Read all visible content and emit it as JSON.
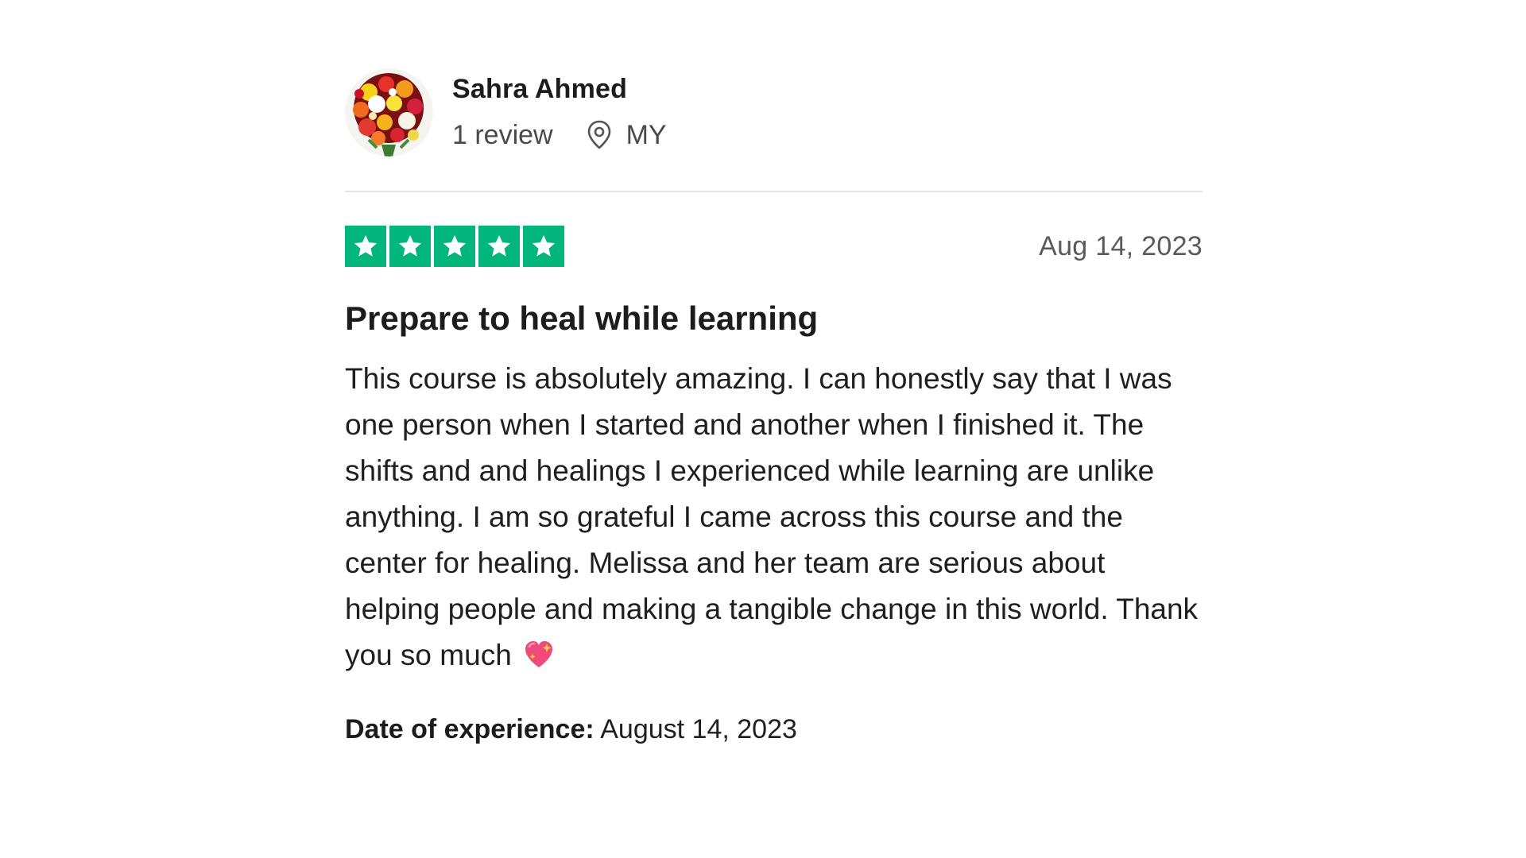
{
  "reviewer": {
    "name": "Sahra Ahmed",
    "review_count": "1 review",
    "country": "MY",
    "avatar_icon": "flower-bouquet-avatar"
  },
  "review": {
    "rating": 5,
    "rating_max": 5,
    "star_color": "#00b67a",
    "date": "Aug 14, 2023",
    "title": "Prepare to heal while learning",
    "body": "This course is absolutely amazing. I can honestly say that I was one person when I started and another when I finished it. The shifts and and healings I experienced while learning are unlike anything. I am so grateful I came across this course and the center for healing. Melissa and her team are serious about helping people and making a tangible change in this world. Thank you so much",
    "body_emoji_icon": "sparkling-heart-icon",
    "experience_label": "Date of experience:",
    "experience_date": "August 14, 2023"
  }
}
